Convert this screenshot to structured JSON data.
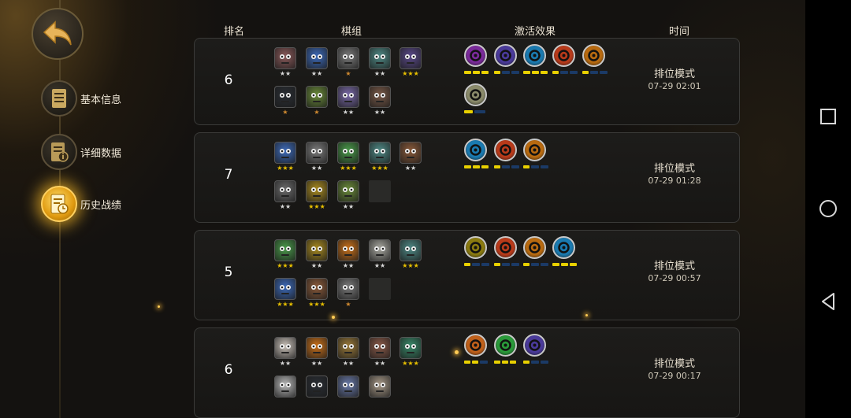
{
  "nav": {
    "items": [
      {
        "label": "基本信息",
        "icon": "document-icon"
      },
      {
        "label": "详细数据",
        "icon": "document-info-icon"
      },
      {
        "label": "历史战绩",
        "icon": "history-clock-icon"
      }
    ],
    "active_index": 2
  },
  "headers": {
    "rank": "排名",
    "lineup": "棋组",
    "traits": "激活效果",
    "time": "时间"
  },
  "colors": {
    "gold_star": "#e8c000",
    "silver_star": "#d8d8d8",
    "bronze_star": "#d08a30",
    "trait_bar_on": "#e8d000",
    "trait_bar_off": "#1b3a66",
    "active_nav_glow": "#ffc02a"
  },
  "matches": [
    {
      "rank": "6",
      "mode": "排位模式",
      "date": "07-29 02:01",
      "units": [
        {
          "color": "#8a5a5a",
          "stars": "★★",
          "tier": "silver"
        },
        {
          "color": "#3d6ab8",
          "stars": "★★",
          "tier": "silver"
        },
        {
          "color": "#7b7b7b",
          "stars": "★",
          "tier": "bronze"
        },
        {
          "color": "#4f8a86",
          "stars": "★★",
          "tier": "silver"
        },
        {
          "color": "#5b4a8a",
          "stars": "★★★",
          "tier": "gold"
        },
        {
          "color": "#2a2e34",
          "stars": "★",
          "tier": "bronze"
        },
        {
          "color": "#6a8a3a",
          "stars": "★",
          "tier": "bronze"
        },
        {
          "color": "#7a6aa8",
          "stars": "★★",
          "tier": "silver"
        },
        {
          "color": "#7a5a48",
          "stars": "★★",
          "tier": "silver"
        }
      ],
      "traits": [
        {
          "color": "#7a2a9a",
          "bar": [
            1,
            1,
            1,
            0
          ]
        },
        {
          "color": "#4a3a9a",
          "bar": [
            1,
            0,
            0
          ]
        },
        {
          "color": "#1a7ab0",
          "bar": [
            1,
            1,
            1,
            0
          ]
        },
        {
          "color": "#b83a1a",
          "bar": [
            1,
            0,
            0
          ]
        },
        {
          "color": "#b86a10",
          "bar": [
            1,
            0,
            0
          ]
        },
        {
          "color": "#8a8a6a",
          "bar": [
            1,
            0
          ]
        }
      ]
    },
    {
      "rank": "7",
      "mode": "排位模式",
      "date": "07-29 01:28",
      "units": [
        {
          "color": "#3d6ab8",
          "stars": "★★★",
          "tier": "gold"
        },
        {
          "color": "#7b7b7b",
          "stars": "★★",
          "tier": "silver"
        },
        {
          "color": "#4a9a4a",
          "stars": "★★★",
          "tier": "gold"
        },
        {
          "color": "#4f8a86",
          "stars": "★★★",
          "tier": "gold"
        },
        {
          "color": "#8a5a3a",
          "stars": "★★",
          "tier": "silver"
        },
        {
          "color": "#6a6a6a",
          "stars": "★★",
          "tier": "silver"
        },
        {
          "color": "#a88a20",
          "stars": "★★★",
          "tier": "gold"
        },
        {
          "color": "#6a8a3a",
          "stars": "★★",
          "tier": "silver"
        },
        {
          "color": "",
          "stars": "",
          "tier": "empty"
        }
      ],
      "traits": [
        {
          "color": "#1a7ab0",
          "bar": [
            1,
            1,
            1,
            0
          ]
        },
        {
          "color": "#b83a1a",
          "bar": [
            1,
            0,
            0
          ]
        },
        {
          "color": "#b86a10",
          "bar": [
            1,
            0,
            0
          ]
        }
      ]
    },
    {
      "rank": "5",
      "mode": "排位模式",
      "date": "07-29 00:57",
      "units": [
        {
          "color": "#4a9a4a",
          "stars": "★★★",
          "tier": "gold"
        },
        {
          "color": "#a88a20",
          "stars": "★★",
          "tier": "silver"
        },
        {
          "color": "#c8701a",
          "stars": "★★",
          "tier": "silver"
        },
        {
          "color": "#a8a8a0",
          "stars": "★★",
          "tier": "silver"
        },
        {
          "color": "#4f8a86",
          "stars": "★★★",
          "tier": "gold"
        },
        {
          "color": "#3d6ab8",
          "stars": "★★★",
          "tier": "gold"
        },
        {
          "color": "#8a5a3a",
          "stars": "★★★",
          "tier": "gold"
        },
        {
          "color": "#7b7b7b",
          "stars": "★",
          "tier": "bronze"
        },
        {
          "color": "",
          "stars": "",
          "tier": "empty"
        }
      ],
      "traits": [
        {
          "color": "#8a7a10",
          "bar": [
            1,
            0,
            0
          ]
        },
        {
          "color": "#b83a1a",
          "bar": [
            1,
            0,
            0
          ]
        },
        {
          "color": "#b86a10",
          "bar": [
            1,
            0,
            0
          ]
        },
        {
          "color": "#1a7ab0",
          "bar": [
            1,
            1,
            1,
            0
          ]
        }
      ]
    },
    {
      "rank": "6",
      "mode": "排位模式",
      "date": "07-29 00:17",
      "units": [
        {
          "color": "#c8c0b8",
          "stars": "★★",
          "tier": "silver"
        },
        {
          "color": "#c8701a",
          "stars": "★★",
          "tier": "silver"
        },
        {
          "color": "#9a7a3a",
          "stars": "★★",
          "tier": "silver"
        },
        {
          "color": "#8a5a48",
          "stars": "★★",
          "tier": "silver"
        },
        {
          "color": "#3a8a6a",
          "stars": "★★★",
          "tier": "gold"
        },
        {
          "color": "#b8b8b8",
          "stars": "",
          "tier": "none"
        },
        {
          "color": "#2a2e34",
          "stars": "",
          "tier": "none"
        },
        {
          "color": "#6a7aa8",
          "stars": "",
          "tier": "none"
        },
        {
          "color": "#a89a88",
          "stars": "",
          "tier": "none"
        }
      ],
      "traits": [
        {
          "color": "#c0601a",
          "bar": [
            1,
            1,
            0
          ]
        },
        {
          "color": "#2a9a3a",
          "bar": [
            1,
            1,
            1
          ]
        },
        {
          "color": "#4a3a9a",
          "bar": [
            1,
            0,
            0
          ]
        }
      ]
    }
  ],
  "system_nav": {
    "buttons": [
      "recent-apps-icon",
      "home-icon",
      "back-triangle-icon"
    ]
  }
}
